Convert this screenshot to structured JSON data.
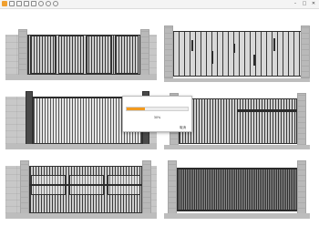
{
  "window": {
    "title": "",
    "buttons": {
      "minimize": "–",
      "maximize": "□",
      "close": "✕"
    }
  },
  "toolbar": {
    "icons": [
      "app-logo-icon",
      "new-icon",
      "open-icon",
      "save-icon",
      "export-icon",
      "undo-icon",
      "redo-icon",
      "settings-icon"
    ]
  },
  "progress_dialog": {
    "title": "",
    "progress_percent": 30,
    "percent_label": "30%",
    "cancel_label": "取消",
    "colors": {
      "fill": "#f29a1f"
    }
  },
  "scene": {
    "tiles": [
      {
        "name": "gate-option-1",
        "style": "vertical slat panels"
      },
      {
        "name": "gate-option-2",
        "style": "staggered vertical bars"
      },
      {
        "name": "gate-option-3",
        "style": "fine slat sliding gate"
      },
      {
        "name": "gate-option-4",
        "style": "vertical bars with horizontal rail"
      },
      {
        "name": "gate-option-5",
        "style": "slat panels with horizontal bands"
      },
      {
        "name": "gate-option-6",
        "style": "dense dark vertical bars"
      }
    ]
  }
}
